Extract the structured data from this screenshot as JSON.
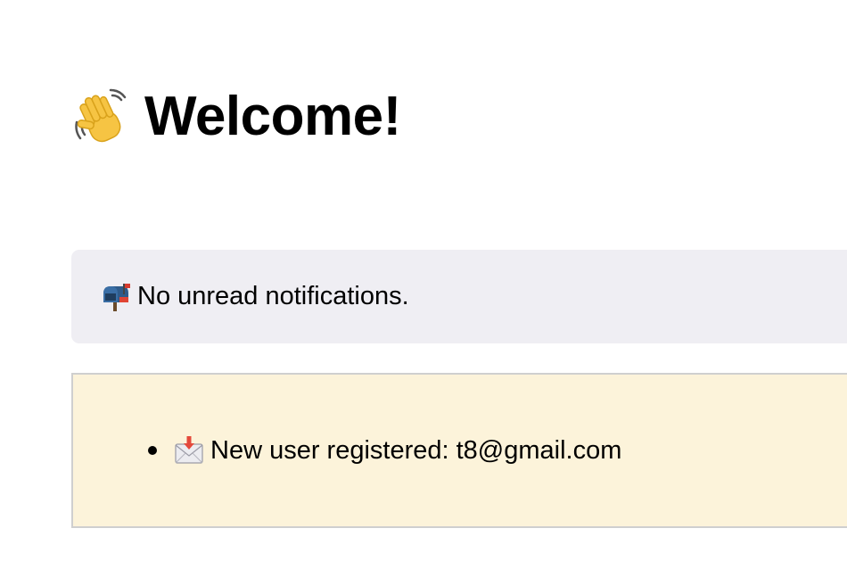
{
  "header": {
    "icon": "waving-hand-icon",
    "title": "Welcome!"
  },
  "notifications": {
    "icon": "mailbox-icon",
    "status_text": "No unread notifications.",
    "background": "#efeef3"
  },
  "activity": {
    "background": "#fcf3da",
    "items": [
      {
        "icon": "incoming-envelope-icon",
        "text": "New user registered: t8@gmail.com"
      }
    ]
  }
}
